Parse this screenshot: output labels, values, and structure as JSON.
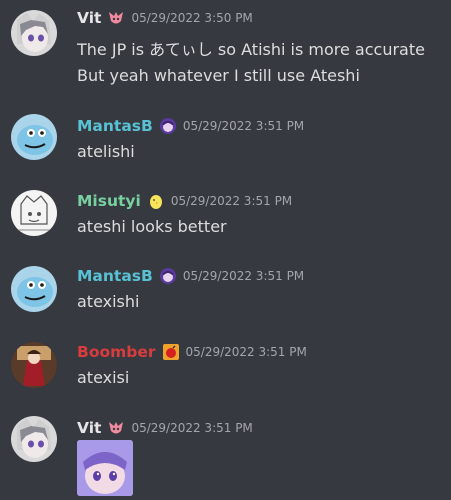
{
  "messages": [
    {
      "username": "Vit",
      "username_color": "#e6e6e6",
      "timestamp": "05/29/2022 3:50 PM",
      "lines": [
        "The JP is あてぃし so Atishi is more accurate",
        "But yeah whatever I still use Ateshi"
      ]
    },
    {
      "username": "MantasB",
      "username_color": "#58c2d4",
      "timestamp": "05/29/2022 3:51 PM",
      "lines": [
        "atelishi"
      ]
    },
    {
      "username": "Misutyi",
      "username_color": "#78d0a0",
      "timestamp": "05/29/2022 3:51 PM",
      "lines": [
        "ateshi looks better"
      ]
    },
    {
      "username": "MantasB",
      "username_color": "#58c2d4",
      "timestamp": "05/29/2022 3:51 PM",
      "lines": [
        "atexishi"
      ]
    },
    {
      "username": "Boomber",
      "username_color": "#d83c3c",
      "timestamp": "05/29/2022 3:51 PM",
      "lines": [
        "atexisi"
      ]
    },
    {
      "username": "Vit",
      "username_color": "#e6e6e6",
      "timestamp": "05/29/2022 3:51 PM",
      "attachment": "image"
    }
  ]
}
